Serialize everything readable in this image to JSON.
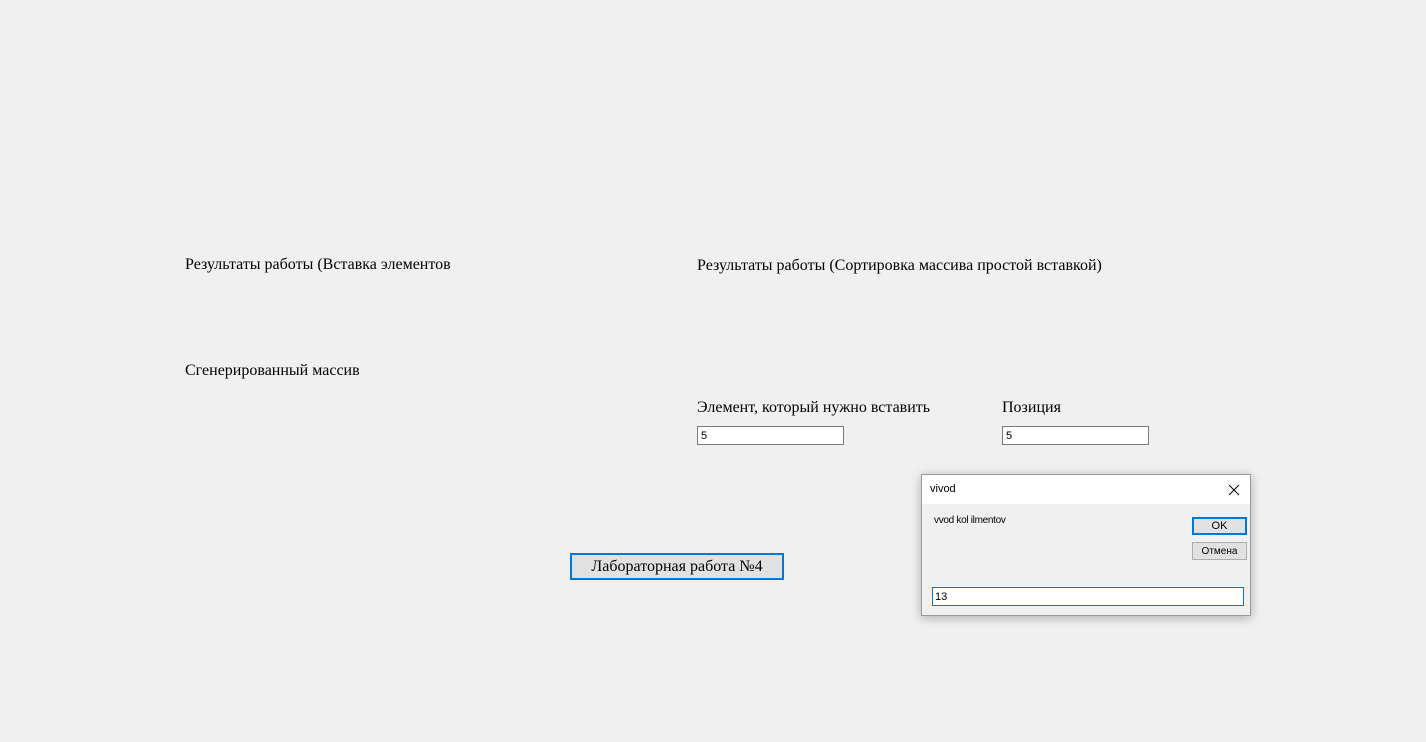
{
  "labels": {
    "results_insert": "Результаты работы (Вставка элементов",
    "results_sort": "Результаты работы (Сортировка массива простой вставкой)",
    "generated_array": "Сгенерированный массив",
    "element_to_insert": "Элемент, который нужно вставить",
    "position": "Позиция"
  },
  "inputs": {
    "element_value": "5",
    "position_value": "5"
  },
  "buttons": {
    "lab_work": "Лабораторная работа №4"
  },
  "dialog": {
    "title": "vivod",
    "prompt": "vvod kol ilmentov",
    "ok_label": "OK",
    "cancel_label": "Отмена",
    "input_value": "13",
    "close_icon": "close-icon"
  },
  "colors": {
    "background": "#f0f0f0",
    "accent": "#0078d7"
  }
}
